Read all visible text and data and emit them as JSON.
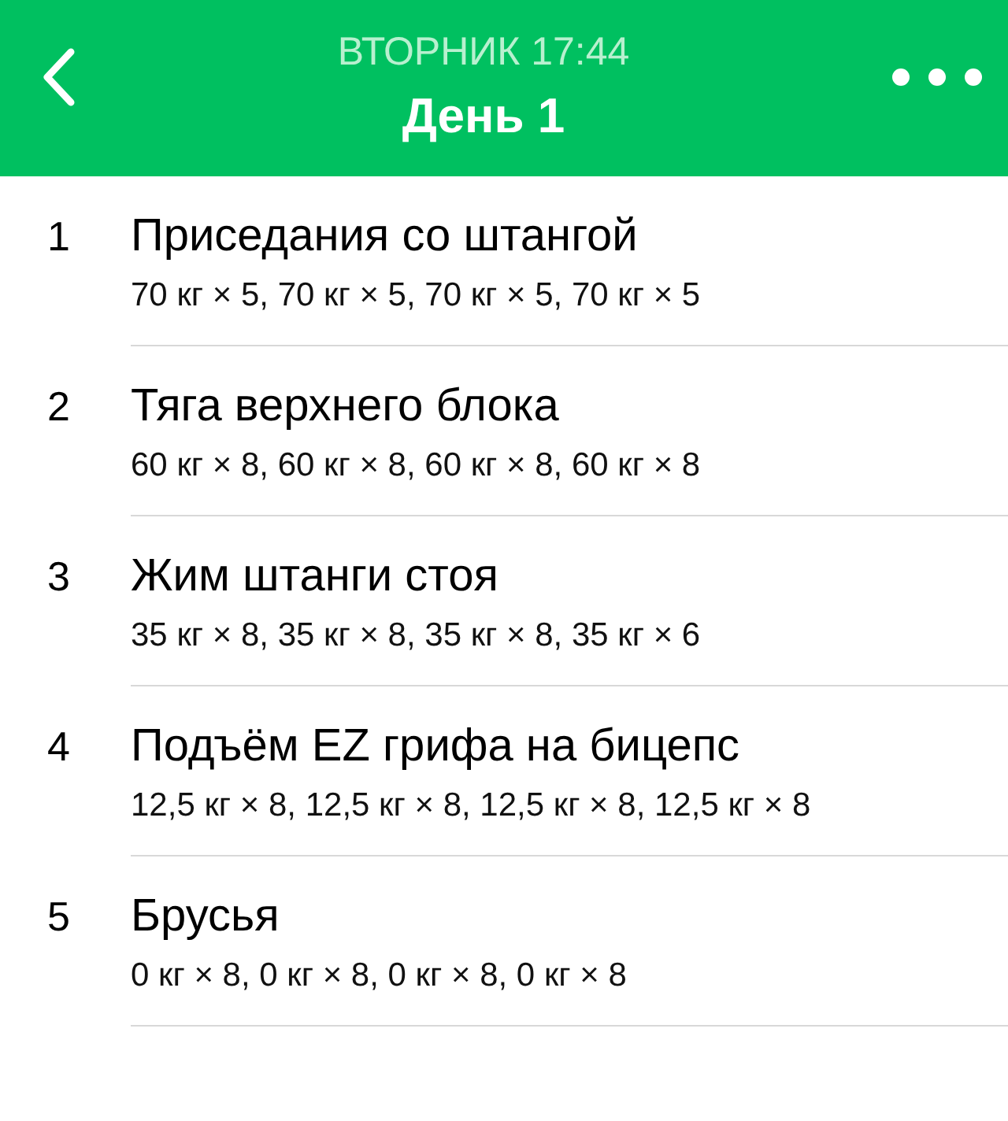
{
  "header": {
    "subtitle": "ВТОРНИК 17:44",
    "title": "День 1"
  },
  "exercises": [
    {
      "number": "1",
      "name": "Приседания со штангой",
      "sets": "70 кг × 5, 70 кг × 5, 70 кг × 5, 70 кг × 5"
    },
    {
      "number": "2",
      "name": "Тяга верхнего блока",
      "sets": "60 кг × 8, 60 кг × 8, 60 кг × 8, 60 кг × 8"
    },
    {
      "number": "3",
      "name": "Жим штанги стоя",
      "sets": "35 кг × 8, 35 кг × 8, 35 кг × 8, 35 кг × 6"
    },
    {
      "number": "4",
      "name": "Подъём EZ грифа на бицепс",
      "sets": "12,5 кг × 8, 12,5 кг × 8, 12,5 кг × 8, 12,5 кг × 8"
    },
    {
      "number": "5",
      "name": "Брусья",
      "sets": "0 кг × 8, 0 кг × 8, 0 кг × 8, 0 кг × 8"
    }
  ]
}
